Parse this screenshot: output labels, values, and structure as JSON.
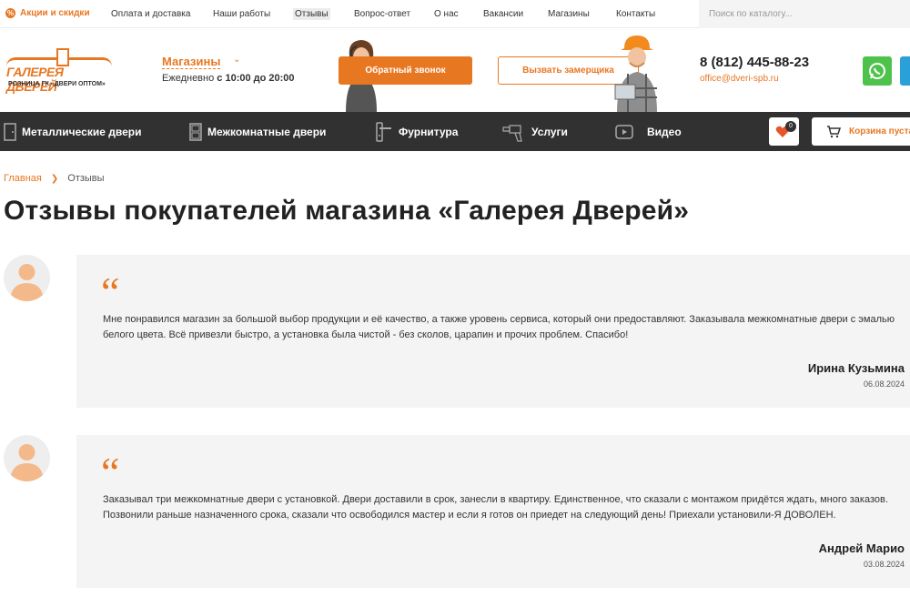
{
  "topbar": {
    "promo_label": "Акции и скидки",
    "nav": [
      "Оплата и доставка",
      "Наши работы",
      "Отзывы",
      "Вопрос-ответ",
      "О нас",
      "Вакансии",
      "Магазины",
      "Контакты"
    ],
    "active_nav": "Отзывы",
    "search_placeholder": "Поиск по каталогу..."
  },
  "header": {
    "logo_title": "ГАЛЕРЕЯ ДВЕРЕЙ",
    "logo_subtitle": "РОЗНИЦА ГК «ДВЕРИ ОПТОМ»",
    "stores_label": "Магазины",
    "hours_prefix": "Ежедневно",
    "hours_value": "с 10:00 до 20:00",
    "callback_button": "Обратный звонок",
    "measurer_button": "Вызвать замерщика",
    "phone": "8 (812) 445-88-23",
    "email": "office@dveri-spb.ru"
  },
  "menu": {
    "items": [
      "Металлические двери",
      "Межкомнатные двери",
      "Фурнитура",
      "Услуги",
      "Видео"
    ],
    "favorites_count": "0",
    "cart_label": "Корзина пуста"
  },
  "breadcrumb": {
    "home": "Главная",
    "current": "Отзывы"
  },
  "page_title": "Отзывы покупателей магазина «Галерея Дверей»",
  "reviews": [
    {
      "text": "Мне понравился магазин за большой выбор продукции и её качество, а также уровень сервиса, который они предоставляют. Заказывала межкомнатные двери с эмалью белого цвета. Всё привезли быстро, а установка была чистой - без сколов, царапин и прочих проблем. Спасибо!",
      "author": "Ирина Кузьмина",
      "date": "06.08.2024"
    },
    {
      "text": "Заказывал три межкомнатные двери с установкой. Двери доставили в срок, занесли в квартиру. Единственное, что сказали с монтажом придётся ждать, много заказов. Позвонили раньше назначенного срока, сказали что освободился мастер и если я готов он приедет на следующий день! Приехали установили-Я ДОВОЛЕН.",
      "author": "Андрей Марио",
      "date": "03.08.2024"
    }
  ],
  "colors": {
    "accent": "#e87722",
    "menu_bg": "#313131",
    "card_bg": "#f4f4f4",
    "whatsapp": "#4fc24b"
  }
}
